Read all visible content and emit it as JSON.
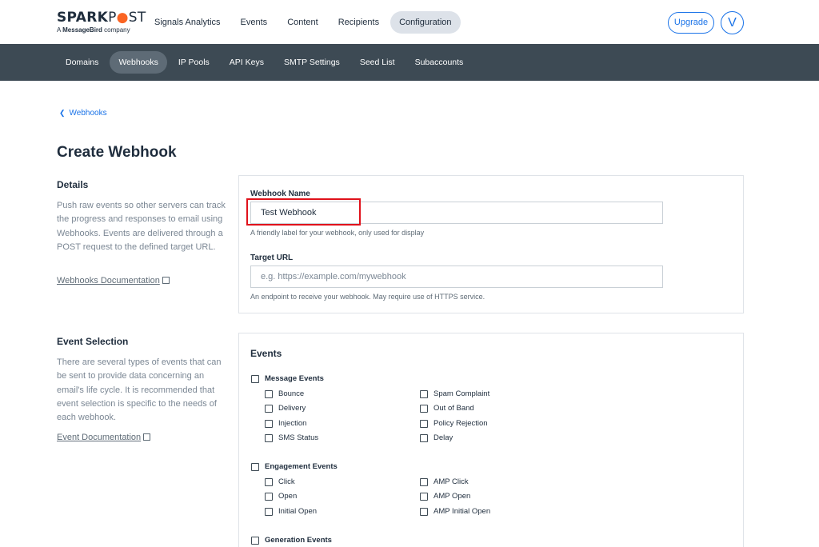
{
  "brand": {
    "name_a": "SPARK",
    "name_b": "P",
    "name_c": "ST",
    "sub_a": "A ",
    "sub_b": "MessageBird",
    "sub_c": " company",
    "accent": "#fa6423"
  },
  "top_nav": {
    "items": [
      "Signals Analytics",
      "Events",
      "Content",
      "Recipients",
      "Configuration"
    ],
    "active": "Configuration",
    "upgrade_label": "Upgrade",
    "avatar_initial": "V"
  },
  "sub_nav": {
    "items": [
      "Domains",
      "Webhooks",
      "IP Pools",
      "API Keys",
      "SMTP Settings",
      "Seed List",
      "Subaccounts"
    ],
    "active": "Webhooks"
  },
  "breadcrumb": {
    "label": "Webhooks",
    "icon": "chevron-left-icon"
  },
  "page": {
    "title": "Create Webhook"
  },
  "details": {
    "title": "Details",
    "description": "Push raw events so other servers can track the progress and responses to email using Webhooks. Events are delivered through a POST request to the defined target URL.",
    "doc_link": "Webhooks Documentation"
  },
  "form": {
    "name_label": "Webhook Name",
    "name_value": "Test Webhook",
    "name_help": "A friendly label for your webhook, only used for display",
    "url_label": "Target URL",
    "url_placeholder": "e.g. https://example.com/mywebhook",
    "url_help": "An endpoint to receive your webhook. May require use of HTTPS service."
  },
  "event_selection": {
    "title": "Event Selection",
    "description": "There are several types of events that can be sent to provide data concerning an email's life cycle. It is recommended that event selection is specific to the needs of each webhook.",
    "doc_link": "Event Documentation"
  },
  "events": {
    "title": "Events",
    "groups": [
      {
        "label": "Message Events",
        "col1": [
          "Bounce",
          "Delivery",
          "Injection",
          "SMS Status"
        ],
        "col2": [
          "Spam Complaint",
          "Out of Band",
          "Policy Rejection",
          "Delay"
        ]
      },
      {
        "label": "Engagement Events",
        "col1": [
          "Click",
          "Open",
          "Initial Open"
        ],
        "col2": [
          "AMP Click",
          "AMP Open",
          "AMP Initial Open"
        ]
      },
      {
        "label": "Generation Events",
        "col1": [],
        "col2": []
      }
    ]
  },
  "colors": {
    "link_blue": "#1a73e8",
    "subnav_bg": "#3d4a54",
    "highlight_red": "#e0121b"
  }
}
